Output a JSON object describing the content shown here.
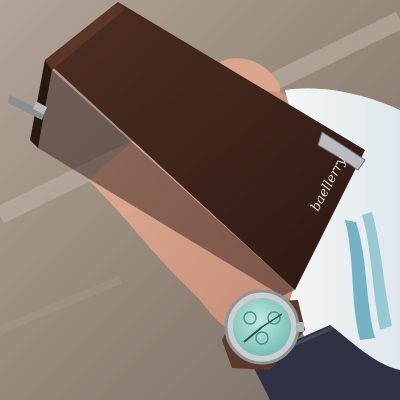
{
  "photo": {
    "brand_text": "baellerry",
    "colors": {
      "ground_light": "#a7998e",
      "ground_dark": "#7e726a",
      "wallet_leather": "#3e241b",
      "wallet_highlight": "#5a3528",
      "skin": "#d9a58c",
      "skin_shadow": "#b77e68",
      "sleeve_white": "#e8eef2",
      "sleeve_teal_accent": "#5fa8bb",
      "jacket_navy": "#2f3242",
      "watch_dial": "#8fcfc6",
      "watch_case": "#c9ced1",
      "watch_strap": "#5b3a2c",
      "metal_clasp": "#b8bcc0"
    }
  }
}
